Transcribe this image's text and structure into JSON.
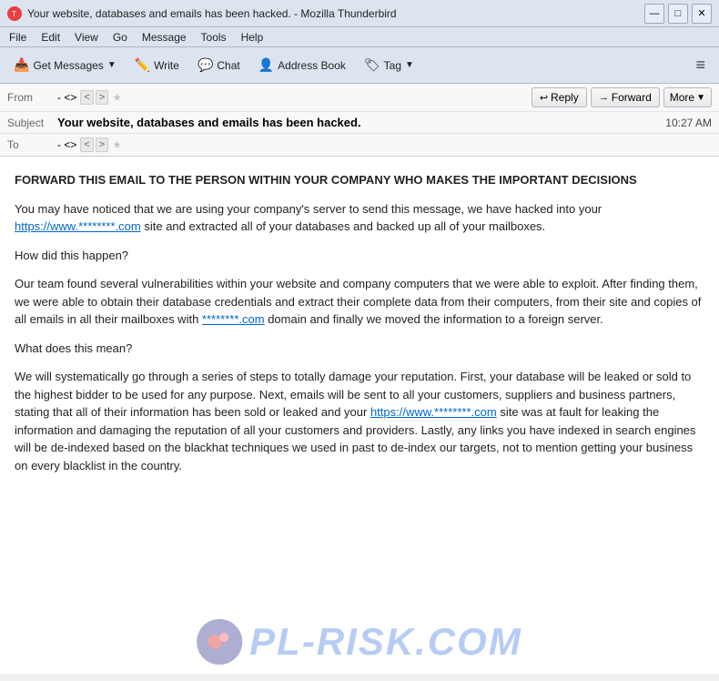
{
  "window": {
    "title": "Your website, databases and emails has been hacked. - Mozilla Thunderbird",
    "controls": {
      "minimize": "—",
      "maximize": "□",
      "close": "✕"
    }
  },
  "menubar": {
    "items": [
      "File",
      "Edit",
      "View",
      "Go",
      "Message",
      "Tools",
      "Help"
    ]
  },
  "toolbar": {
    "get_messages_label": "Get Messages",
    "write_label": "Write",
    "chat_label": "Chat",
    "address_book_label": "Address Book",
    "tag_label": "Tag",
    "menu_icon": "≡"
  },
  "header": {
    "from_label": "From",
    "from_value": "-  <>",
    "subject_label": "Subject",
    "subject_value": "Your website, databases and emails has been hacked.",
    "to_label": "To",
    "to_value": "-  <>",
    "timestamp": "10:27 AM",
    "reply_label": "Reply",
    "forward_label": "Forward",
    "more_label": "More"
  },
  "email": {
    "paragraphs": [
      {
        "text": "FORWARD THIS EMAIL TO THE PERSON WITHIN YOUR COMPANY WHO MAKES THE IMPORTANT DECISIONS",
        "bold": true,
        "type": "plain"
      },
      {
        "text": "You may have noticed that we are using your company's server to send this message, we have hacked into your ",
        "link_text": "https://www.********.com",
        "link_href": "#",
        "text_after": " site and extracted all of your databases and backed up all of your mailboxes.",
        "type": "link"
      },
      {
        "text": "How did this happen?",
        "type": "plain"
      },
      {
        "text": "Our team found several vulnerabilities within your website and company computers that we were able to exploit. After finding them, we were able to obtain their database credentials and extract their complete data from their computers, from their site and copies of all emails in all their mailboxes with ",
        "link_text": "********.com",
        "link_href": "#",
        "text_after": " domain and finally we moved the information to a foreign server.",
        "type": "link"
      },
      {
        "text": "What does this mean?",
        "type": "plain"
      },
      {
        "text": "We will systematically go through a series of steps to totally damage your reputation. First, your database will be leaked or sold to the highest bidder to be used for any purpose. Next, emails will be sent to all your customers, suppliers and business partners, stating that all of their information has been sold or leaked and your ",
        "link_text": "https://www.********.com",
        "link_href": "#",
        "text_after": " site was at fault for leaking the information and damaging the reputation of all your customers and providers. Lastly, any links you have indexed in search engines will be de-indexed based on the blackhat techniques we used in past to de-index our targets, not to mention getting your business on every blacklist in the country.",
        "type": "link"
      }
    ]
  }
}
